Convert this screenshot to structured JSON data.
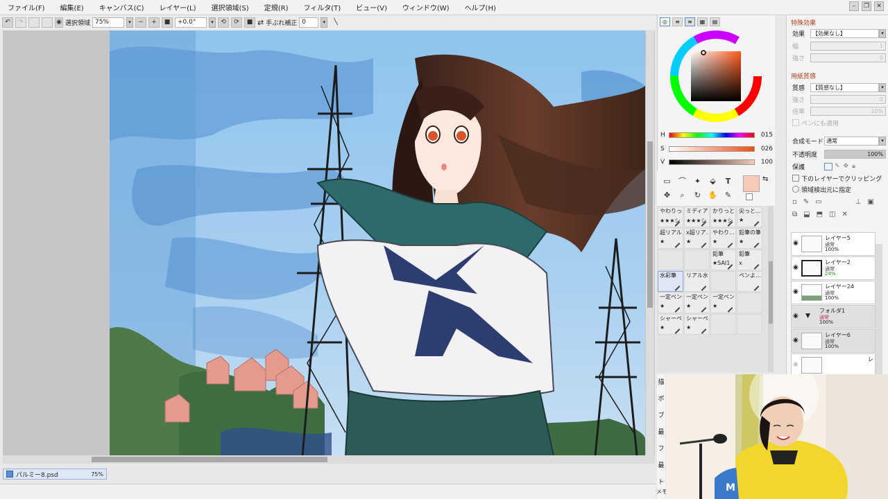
{
  "menu": [
    "ファイル(F)",
    "編集(E)",
    "キャンバス(C)",
    "レイヤー(L)",
    "選択領域(S)",
    "定規(R)",
    "フィルタ(T)",
    "ビュー(V)",
    "ウィンドウ(W)",
    "ヘルプ(H)"
  ],
  "toolbar": {
    "selection_label": "選択領域",
    "zoom": "75%",
    "rotation": "+0.0°",
    "stabilizer_label": "手ぶれ補正",
    "stabilizer_value": "0"
  },
  "file_tab": {
    "name": "パルミー8.psd",
    "zoom": "75%"
  },
  "color": {
    "h_label": "H",
    "h": "015",
    "s_label": "S",
    "s": "026",
    "v_label": "V",
    "v": "100",
    "current": "#f6c9b8"
  },
  "brushes": [
    {
      "name": "やわりっ...",
      "size": "★★★シ"
    },
    {
      "name": "ミディア...",
      "size": "★★★シ"
    },
    {
      "name": "かりっと...",
      "size": "★★★シ"
    },
    {
      "name": "尖っと...",
      "size": "★"
    },
    {
      "name": "超リアル...",
      "size": "★"
    },
    {
      "name": "x超リア...",
      "size": "★"
    },
    {
      "name": "やわり...",
      "size": "★"
    },
    {
      "name": "鉛筆の筆",
      "size": "★"
    },
    {
      "name": "",
      "size": ""
    },
    {
      "name": "",
      "size": ""
    },
    {
      "name": "鉛筆",
      "size": "★SAI1"
    },
    {
      "name": "鉛筆",
      "size": "x"
    },
    {
      "name": "水彩筆",
      "size": ""
    },
    {
      "name": "リアル水彩",
      "size": ""
    },
    {
      "name": "",
      "size": ""
    },
    {
      "name": "ペンよ...",
      "size": ""
    },
    {
      "name": "一定ペン",
      "size": "★"
    },
    {
      "name": "一定ペン",
      "size": "★"
    },
    {
      "name": "一定ペン",
      "size": "★"
    },
    {
      "name": "",
      "size": ""
    },
    {
      "name": "シャーペン",
      "size": "★"
    },
    {
      "name": "シャーペン",
      "size": "★"
    },
    {
      "name": "",
      "size": ""
    },
    {
      "name": "",
      "size": ""
    }
  ],
  "effects": {
    "title": "特殊効果",
    "effect_label": "効果",
    "effect_value": "【効果なし】",
    "width_label": "幅",
    "width_value": "1",
    "strength_label": "強さ",
    "strength_value": "0"
  },
  "paper": {
    "title": "用紙質感",
    "texture_label": "質感",
    "texture_value": "【質感なし】",
    "strength_label": "強さ",
    "strength_value": "0",
    "scale_label": "倍率",
    "scale_value": "10%",
    "pen_label": "ペンにも適用"
  },
  "layer_props": {
    "blend_label": "合成モード",
    "blend_value": "通常",
    "opacity_label": "不透明度",
    "opacity_value": "100%",
    "protect_label": "保護",
    "clip_label": "下のレイヤーでクリッピング",
    "source_label": "領域検出元に指定"
  },
  "layers": [
    {
      "name": "レイヤー5",
      "mode": "通常",
      "opacity": "100%"
    },
    {
      "name": "レイヤー2",
      "mode": "通常",
      "opacity": "24%"
    },
    {
      "name": "レイヤー24",
      "mode": "通常",
      "opacity": "100%"
    },
    {
      "name": "フォルダ1",
      "mode": "通常",
      "opacity": "100%"
    },
    {
      "name": "レイヤー6",
      "mode": "通常",
      "opacity": "100%"
    },
    {
      "name": "レ",
      "mode": "",
      "opacity": ""
    }
  ],
  "side_labels": [
    "描",
    "ボ",
    "ブ",
    "最",
    "フ",
    "最",
    "ト"
  ],
  "status": "メモ"
}
